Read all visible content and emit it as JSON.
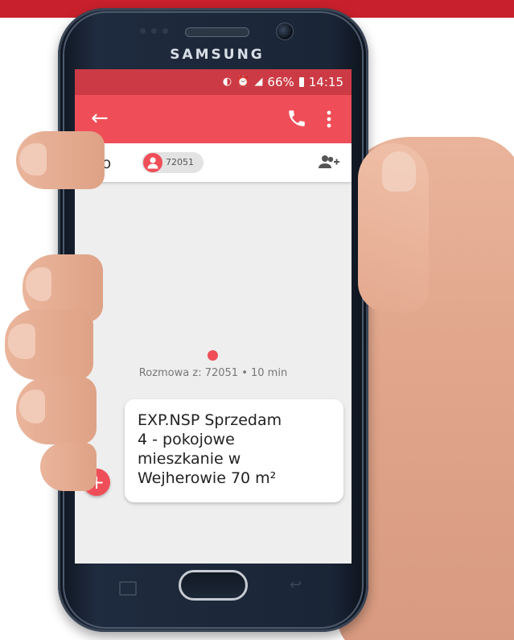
{
  "device": {
    "brand": "SAMSUNG"
  },
  "status_bar": {
    "battery": "66%",
    "time": "14:15",
    "icons": [
      "sync-icon",
      "alarm-icon",
      "signal-icon",
      "battery-icon"
    ]
  },
  "app_bar": {
    "back_icon": "arrow-left-icon",
    "call_icon": "phone-icon",
    "more_icon": "more-vert-icon"
  },
  "recipient": {
    "label": "Do",
    "contact": "72051",
    "add_icon": "add-contact-icon"
  },
  "conversation": {
    "info": "Rozmowa z: 72051 • 10 min"
  },
  "message": {
    "lines": [
      "EXP.NSP Sprzedam",
      "4 - pokojowe",
      "mieszkanie w",
      "Wejherowie 70 m²"
    ]
  },
  "fab": {
    "label": "+"
  },
  "colors": {
    "status_bar": "#cc3b45",
    "app_bar": "#ef4e58",
    "accent": "#ef4e58",
    "top_band": "#c8202c"
  }
}
